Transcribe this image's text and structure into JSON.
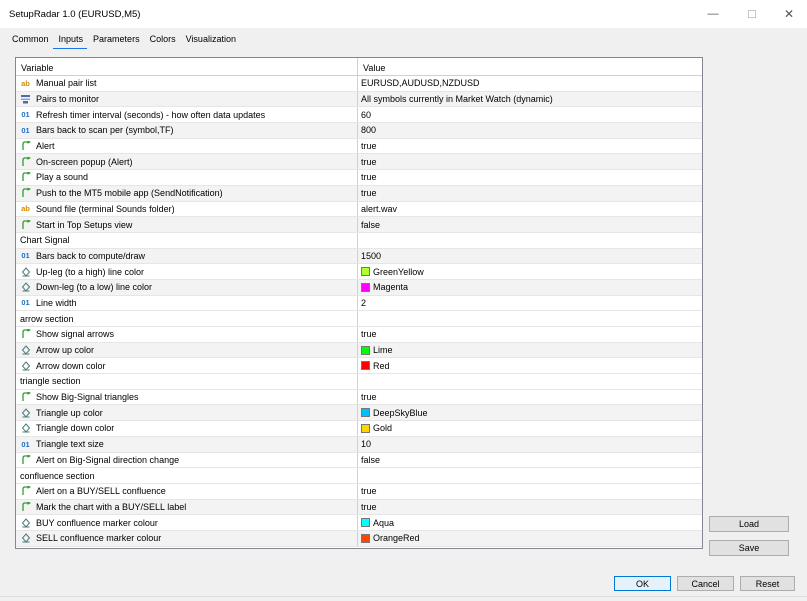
{
  "window": {
    "title": "SetupRadar 1.0 (EURUSD,M5)",
    "minimize_glyph": "—",
    "maximize_glyph": "☐",
    "close_glyph": "✕"
  },
  "tabs": [
    {
      "label": "Common",
      "active": false
    },
    {
      "label": "Inputs",
      "active": true
    },
    {
      "label": "Parameters",
      "active": false
    },
    {
      "label": "Colors",
      "active": false
    },
    {
      "label": "Visualization",
      "active": false
    }
  ],
  "grid": {
    "header": {
      "variable": "Variable",
      "value": "Value"
    },
    "rows": [
      {
        "kind": "param",
        "icon": "string-icon",
        "label": "Manual pair list",
        "value": "EURUSD,AUDUSD,NZDUSD"
      },
      {
        "kind": "param",
        "icon": "enum-icon",
        "label": "Pairs to monitor",
        "value": "All symbols currently in Market Watch (dynamic)"
      },
      {
        "kind": "param",
        "icon": "number-icon",
        "label": "Refresh timer interval (seconds) - how often data updates",
        "value": "60"
      },
      {
        "kind": "param",
        "icon": "number-icon",
        "label": "Bars back to scan per (symbol,TF)",
        "value": "800"
      },
      {
        "kind": "param",
        "icon": "bool-icon",
        "label": "Alert",
        "value": "true"
      },
      {
        "kind": "param",
        "icon": "bool-icon",
        "label": "On-screen popup (Alert)",
        "value": "true"
      },
      {
        "kind": "param",
        "icon": "bool-icon",
        "label": "Play a sound",
        "value": "true"
      },
      {
        "kind": "param",
        "icon": "bool-icon",
        "label": "Push to the MT5 mobile app (SendNotification)",
        "value": "true"
      },
      {
        "kind": "param",
        "icon": "string-icon",
        "label": "Sound file (terminal Sounds folder)",
        "value": "alert.wav"
      },
      {
        "kind": "param",
        "icon": "bool-icon",
        "label": "Start in Top Setups view",
        "value": "false"
      },
      {
        "kind": "section",
        "label": "Chart Signal",
        "value": ""
      },
      {
        "kind": "param",
        "icon": "number-icon",
        "label": "Bars back to compute/draw",
        "value": "1500"
      },
      {
        "kind": "param",
        "icon": "color-icon",
        "label": "Up-leg (to a high) line color",
        "value": "GreenYellow",
        "swatch": "#adff2f"
      },
      {
        "kind": "param",
        "icon": "color-icon",
        "label": "Down-leg (to a low) line color",
        "value": "Magenta",
        "swatch": "#ff00ff"
      },
      {
        "kind": "param",
        "icon": "number-icon",
        "label": "Line width",
        "value": "2"
      },
      {
        "kind": "section",
        "label": "arrow section",
        "value": ""
      },
      {
        "kind": "param",
        "icon": "bool-icon",
        "label": "Show signal arrows",
        "value": "true"
      },
      {
        "kind": "param",
        "icon": "color-icon",
        "label": "Arrow up color",
        "value": "Lime",
        "swatch": "#00ff00"
      },
      {
        "kind": "param",
        "icon": "color-icon",
        "label": "Arrow down color",
        "value": "Red",
        "swatch": "#ff0000"
      },
      {
        "kind": "section",
        "label": "triangle section",
        "value": ""
      },
      {
        "kind": "param",
        "icon": "bool-icon",
        "label": "Show Big-Signal triangles",
        "value": "true"
      },
      {
        "kind": "param",
        "icon": "color-icon",
        "label": "Triangle up color",
        "value": "DeepSkyBlue",
        "swatch": "#00bfff"
      },
      {
        "kind": "param",
        "icon": "color-icon",
        "label": "Triangle down color",
        "value": "Gold",
        "swatch": "#ffd700"
      },
      {
        "kind": "param",
        "icon": "number-icon",
        "label": "Triangle text size",
        "value": "10"
      },
      {
        "kind": "param",
        "icon": "bool-icon",
        "label": "Alert on Big-Signal direction change",
        "value": "false"
      },
      {
        "kind": "section",
        "label": "confluence section",
        "value": ""
      },
      {
        "kind": "param",
        "icon": "bool-icon",
        "label": "Alert on a BUY/SELL confluence",
        "value": "true"
      },
      {
        "kind": "param",
        "icon": "bool-icon",
        "label": "Mark the chart with a BUY/SELL label",
        "value": "true"
      },
      {
        "kind": "param",
        "icon": "color-icon",
        "label": "BUY confluence marker colour",
        "value": "Aqua",
        "swatch": "#00ffff"
      },
      {
        "kind": "param",
        "icon": "color-icon",
        "label": "SELL confluence marker colour",
        "value": "OrangeRed",
        "swatch": "#ff4500"
      }
    ]
  },
  "side_buttons": {
    "load": "Load",
    "save": "Save"
  },
  "bottom_buttons": {
    "ok": "OK",
    "cancel": "Cancel",
    "reset": "Reset"
  },
  "colors": {
    "row_even": "#ffffff",
    "row_odd": "#f3f3f3",
    "section_bg": "#ffffff",
    "grid_line": "#e6e6e6",
    "bool_icon": "#2e9e2e",
    "enum_icon": "#4a6ea9",
    "color_icon": "#4a7a7a"
  }
}
